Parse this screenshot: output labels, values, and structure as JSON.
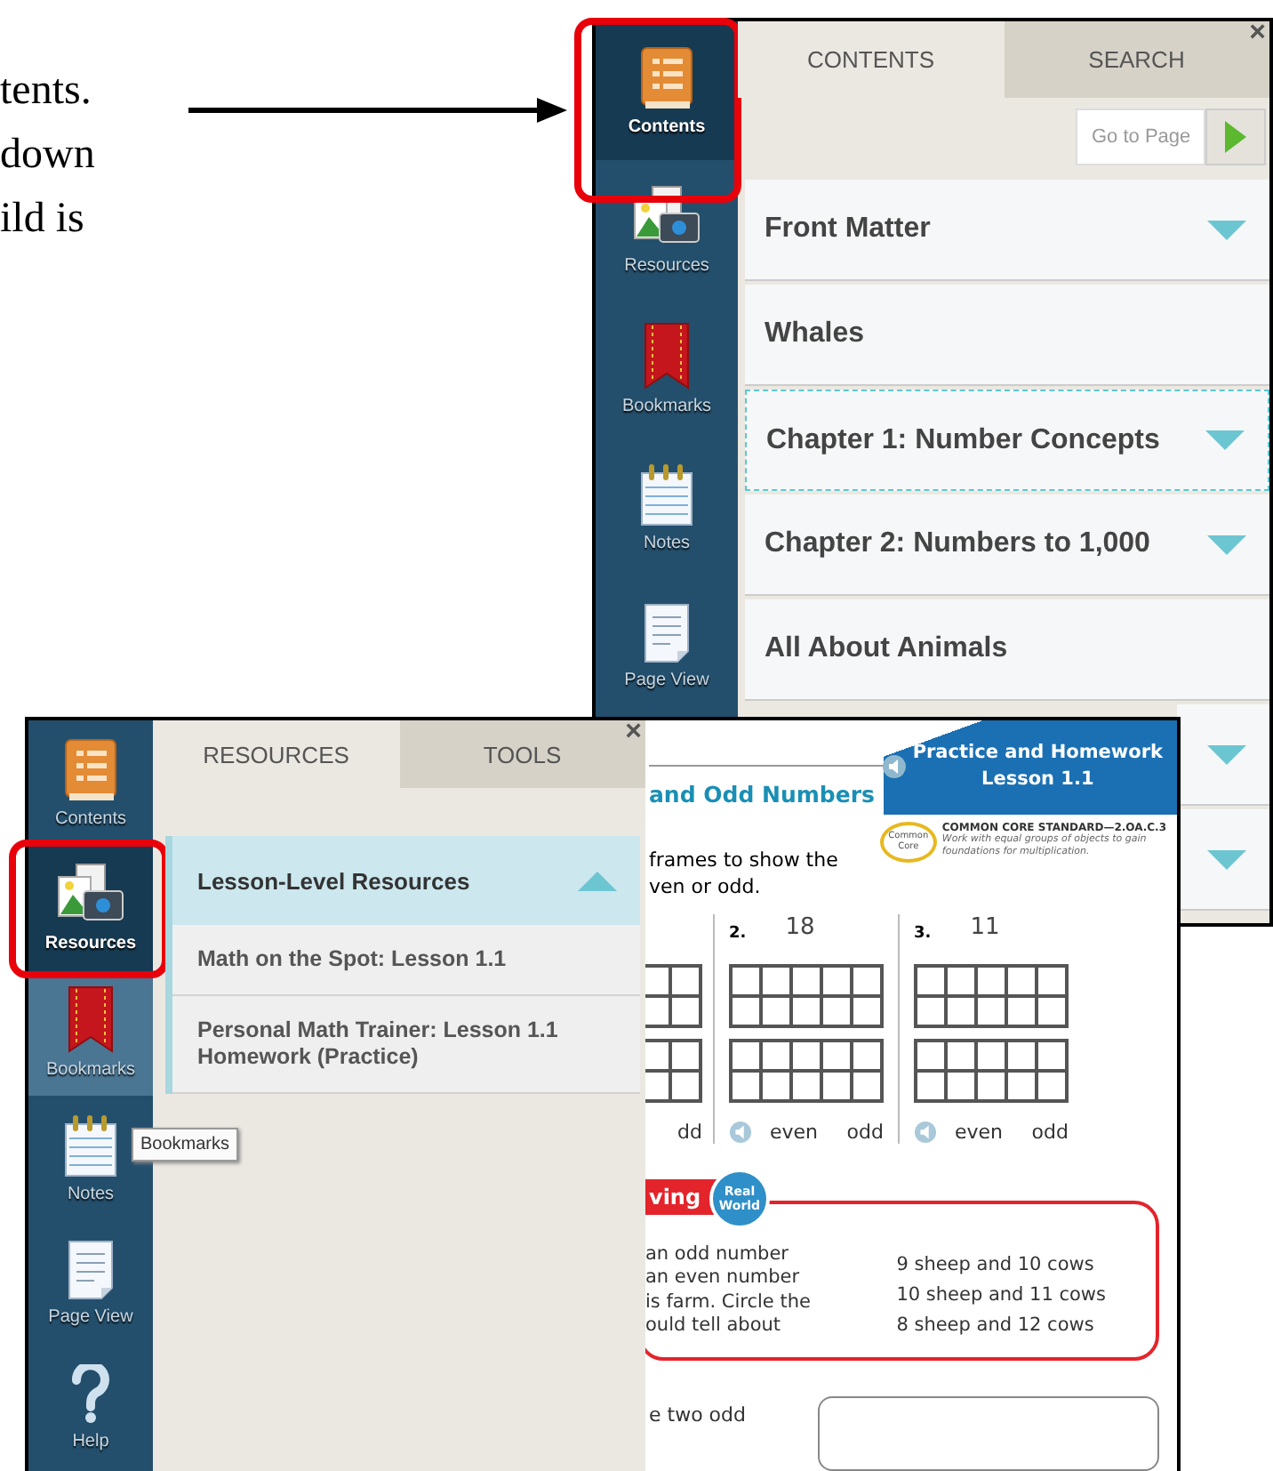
{
  "document_text": {
    "lines": [
      "tents.",
      "down",
      "ild is"
    ]
  },
  "contents_window": {
    "sidebar": [
      {
        "label": "Contents",
        "selected": true,
        "callout": true
      },
      {
        "label": "Resources",
        "selected": false,
        "callout": false
      },
      {
        "label": "Bookmarks",
        "selected": false,
        "callout": false
      },
      {
        "label": "Notes",
        "selected": false,
        "callout": false
      },
      {
        "label": "Page View",
        "selected": false,
        "callout": false
      }
    ],
    "tabs": [
      {
        "label": "CONTENTS",
        "selected": true
      },
      {
        "label": "SEARCH",
        "selected": false
      }
    ],
    "close": "×",
    "go_to_page": {
      "placeholder": "Go to Page"
    },
    "rows": [
      {
        "title": "Front Matter",
        "expandable": true,
        "focused": false
      },
      {
        "title": "Whales",
        "expandable": false,
        "focused": false
      },
      {
        "title": "Chapter 1: Number Concepts",
        "expandable": true,
        "focused": true
      },
      {
        "title": "Chapter 2: Numbers to 1,000",
        "expandable": true,
        "focused": false
      },
      {
        "title": "All About Animals",
        "expandable": false,
        "focused": false
      },
      {
        "expandable": true,
        "focused": false
      },
      {
        "expandable": true,
        "focused": false
      }
    ]
  },
  "resources_window": {
    "sidebar": [
      {
        "label": "Contents",
        "selected": false,
        "hovered": false,
        "callout": false
      },
      {
        "label": "Resources",
        "selected": true,
        "hovered": false,
        "callout": true
      },
      {
        "label": "Bookmarks",
        "selected": false,
        "hovered": true,
        "callout": false
      },
      {
        "label": "Notes",
        "selected": false,
        "hovered": false,
        "callout": false
      },
      {
        "label": "Page View",
        "selected": false,
        "hovered": false,
        "callout": false
      },
      {
        "label": "Help",
        "selected": false,
        "hovered": false,
        "callout": false
      }
    ],
    "tabs": [
      {
        "label": "RESOURCES",
        "selected": true
      },
      {
        "label": "TOOLS",
        "selected": false
      }
    ],
    "close": "×",
    "section": {
      "title": "Lesson-Level Resources",
      "expanded": true,
      "items": [
        "Math on the Spot: Lesson 1.1",
        "Personal Math Trainer: Lesson 1.1 Homework (Practice)"
      ]
    },
    "tooltip": "Bookmarks"
  },
  "worksheet": {
    "banner": [
      "Practice and Homework",
      "Lesson 1.1"
    ],
    "title": "and Odd Numbers",
    "standard": {
      "logo": [
        "Common",
        "Core"
      ],
      "code": "COMMON CORE STANDARD—2.OA.C.3",
      "description": [
        "Work with equal groups of objects to gain",
        "foundations for multiplication."
      ]
    },
    "instructions": [
      "frames to show the",
      "ven or odd."
    ],
    "problems": [
      {
        "choices": [
          "dd"
        ]
      },
      {
        "number": "2.",
        "value": "18",
        "choices": [
          "even",
          "odd"
        ]
      },
      {
        "number": "3.",
        "value": "11",
        "choices": [
          "even",
          "odd"
        ]
      }
    ],
    "real_world": {
      "label": "ving",
      "badge": [
        "Real",
        "World"
      ],
      "question": [
        "an odd number",
        "an even number",
        "is farm. Circle the",
        "ould tell about"
      ],
      "options": [
        "9 sheep and 10 cows",
        "10 sheep and 11 cows",
        "8 sheep and 12 cows"
      ]
    },
    "next_question": "e two odd"
  }
}
